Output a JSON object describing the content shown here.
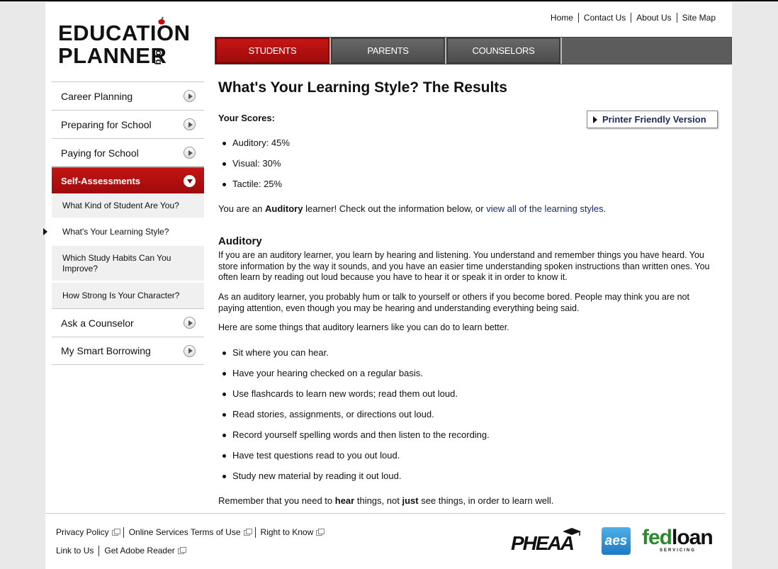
{
  "logo": {
    "line1": "EDUCATION",
    "line2": "PLANNER",
    "suffix": ".org"
  },
  "util_nav": [
    "Home",
    "Contact Us",
    "About Us",
    "Site Map"
  ],
  "tabs": [
    {
      "label": "STUDENTS",
      "active": true
    },
    {
      "label": "PARENTS",
      "active": false
    },
    {
      "label": "COUNSELORS",
      "active": false
    }
  ],
  "sidebar": {
    "items_top": [
      {
        "label": "Career Planning"
      },
      {
        "label": "Preparing for School"
      },
      {
        "label": "Paying for School"
      }
    ],
    "active_item": {
      "label": "Self-Assessments"
    },
    "sub_items": [
      {
        "label": "What Kind of Student Are You?"
      },
      {
        "label": "What's Your Learning Style?",
        "selected": true
      },
      {
        "label": "Which Study Habits Can You Improve?"
      },
      {
        "label": "How Strong Is Your Character?"
      }
    ],
    "items_bottom": [
      {
        "label": "Ask a Counselor"
      },
      {
        "label": "My Smart Borrowing"
      }
    ]
  },
  "content": {
    "title": "What's Your Learning Style? The Results",
    "scores_label": "Your Scores:",
    "printer_label": "Printer Friendly Version",
    "scores": [
      "Auditory: 45%",
      "Visual: 30%",
      "Tactile: 25%"
    ],
    "learner_prefix": "You are an ",
    "learner_type": "Auditory",
    "learner_middle": " learner! Check out the information below, or ",
    "learner_link": "view all of the learning styles",
    "learner_suffix": ".",
    "section_heading": "Auditory",
    "paragraph1": "If you are an auditory learner, you learn by hearing and listening. You understand and remember things you have heard. You store information by the way it sounds, and you have an easier time understanding spoken instructions than written ones. You often learn by reading out loud because you have to hear it or speak it in order to know it.",
    "paragraph2": "As an auditory learner, you probably hum or talk to yourself or others if you become bored. People may think you are not paying attention, even though you may be hearing and understanding everything being said.",
    "paragraph3": "Here are some things that auditory learners like you can do to learn better.",
    "tips": [
      "Sit where you can hear.",
      "Have your hearing checked on a regular basis.",
      "Use flashcards to learn new words; read them out loud.",
      "Read stories, assignments, or directions out loud.",
      "Record yourself spelling words and then listen to the recording.",
      "Have test questions read to you out loud.",
      "Study new material by reading it out loud."
    ],
    "closing_1": "Remember that you need to ",
    "closing_hear": "hear",
    "closing_2": " things, not ",
    "closing_just": "just",
    "closing_3": " see things, in order to learn well."
  },
  "footer": {
    "row1": [
      "Privacy Policy",
      "Online Services Terms of Use",
      "Right to Know"
    ],
    "row2": [
      "Link to Us",
      "Get Adobe Reader"
    ],
    "partners": {
      "pheaa": "PHEAA",
      "aes": "aes",
      "fedloan_fed": "fed",
      "fedloan_loan": "loan",
      "fedloan_sub": "SERVICING"
    }
  },
  "colors": {
    "accent_red": "#b20e0e",
    "tab_gray": "#555555",
    "link_blue": "#1a2a6e"
  }
}
